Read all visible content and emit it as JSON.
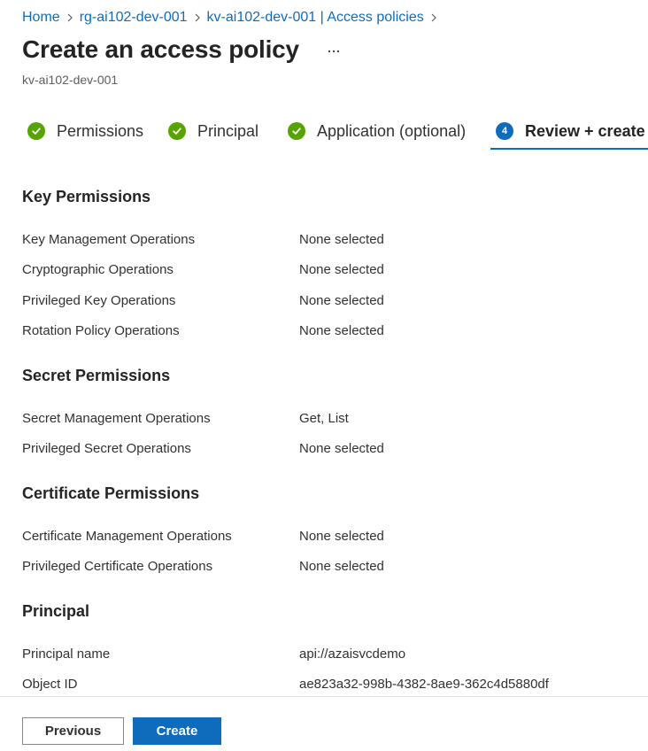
{
  "breadcrumb": {
    "items": [
      "Home",
      "rg-ai102-dev-001",
      "kv-ai102-dev-001 | Access policies"
    ]
  },
  "page": {
    "title": "Create an access policy",
    "subtitle": "kv-ai102-dev-001",
    "more_icon": "ellipsis-icon"
  },
  "steps": [
    {
      "label": "Permissions",
      "state": "complete"
    },
    {
      "label": "Principal",
      "state": "complete"
    },
    {
      "label": "Application (optional)",
      "state": "complete"
    },
    {
      "label": "Review + create",
      "state": "active",
      "number": "4"
    }
  ],
  "sections": {
    "key": {
      "title": "Key Permissions",
      "rows": [
        {
          "label": "Key Management Operations",
          "value": "None selected"
        },
        {
          "label": "Cryptographic Operations",
          "value": "None selected"
        },
        {
          "label": "Privileged Key Operations",
          "value": "None selected"
        },
        {
          "label": "Rotation Policy Operations",
          "value": "None selected"
        }
      ]
    },
    "secret": {
      "title": "Secret Permissions",
      "rows": [
        {
          "label": "Secret Management Operations",
          "value": "Get, List"
        },
        {
          "label": "Privileged Secret Operations",
          "value": "None selected"
        }
      ]
    },
    "certificate": {
      "title": "Certificate Permissions",
      "rows": [
        {
          "label": "Certificate Management Operations",
          "value": "None selected"
        },
        {
          "label": "Privileged Certificate Operations",
          "value": "None selected"
        }
      ]
    },
    "principal": {
      "title": "Principal",
      "rows": [
        {
          "label": "Principal name",
          "value": "api://azaisvcdemo"
        },
        {
          "label": "Object ID",
          "value": "ae823a32-998b-4382-8ae9-362c4d5880df"
        }
      ]
    }
  },
  "footer": {
    "previous_label": "Previous",
    "create_label": "Create"
  },
  "colors": {
    "accent": "#0f6cbd",
    "success": "#57a300"
  }
}
